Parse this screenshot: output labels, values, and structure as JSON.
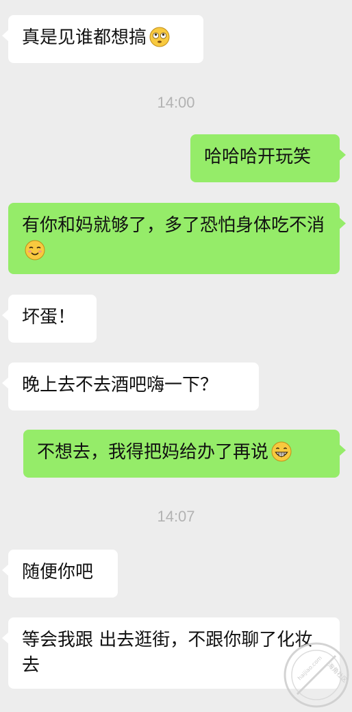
{
  "messages": {
    "m1": {
      "text": "真是见谁都想搞",
      "emoji": "flushed-face-icon"
    },
    "t1": "14:00",
    "m2": {
      "text": "哈哈哈开玩笑"
    },
    "m3": {
      "text": "有你和妈就够了，多了恐怕身体吃不消",
      "emoji": "smiling-face-icon"
    },
    "m4": {
      "text": "坏蛋！"
    },
    "m5": {
      "text": "晚上去不去酒吧嗨一下？"
    },
    "m6": {
      "text": "不想去，我得把妈给办了再说",
      "emoji": "grinning-face-icon"
    },
    "t2": "14:07",
    "m7": {
      "text": "随便你吧"
    },
    "m8": {
      "text": "等会我跟  出去逛街，不跟你聊了化妆去"
    }
  },
  "colors": {
    "background": "#ededed",
    "incoming_bubble": "#ffffff",
    "outgoing_bubble": "#95ec69",
    "timestamp": "#b2b2b2"
  },
  "watermark": {
    "text": "海角社区",
    "url": "haijiao.com"
  }
}
